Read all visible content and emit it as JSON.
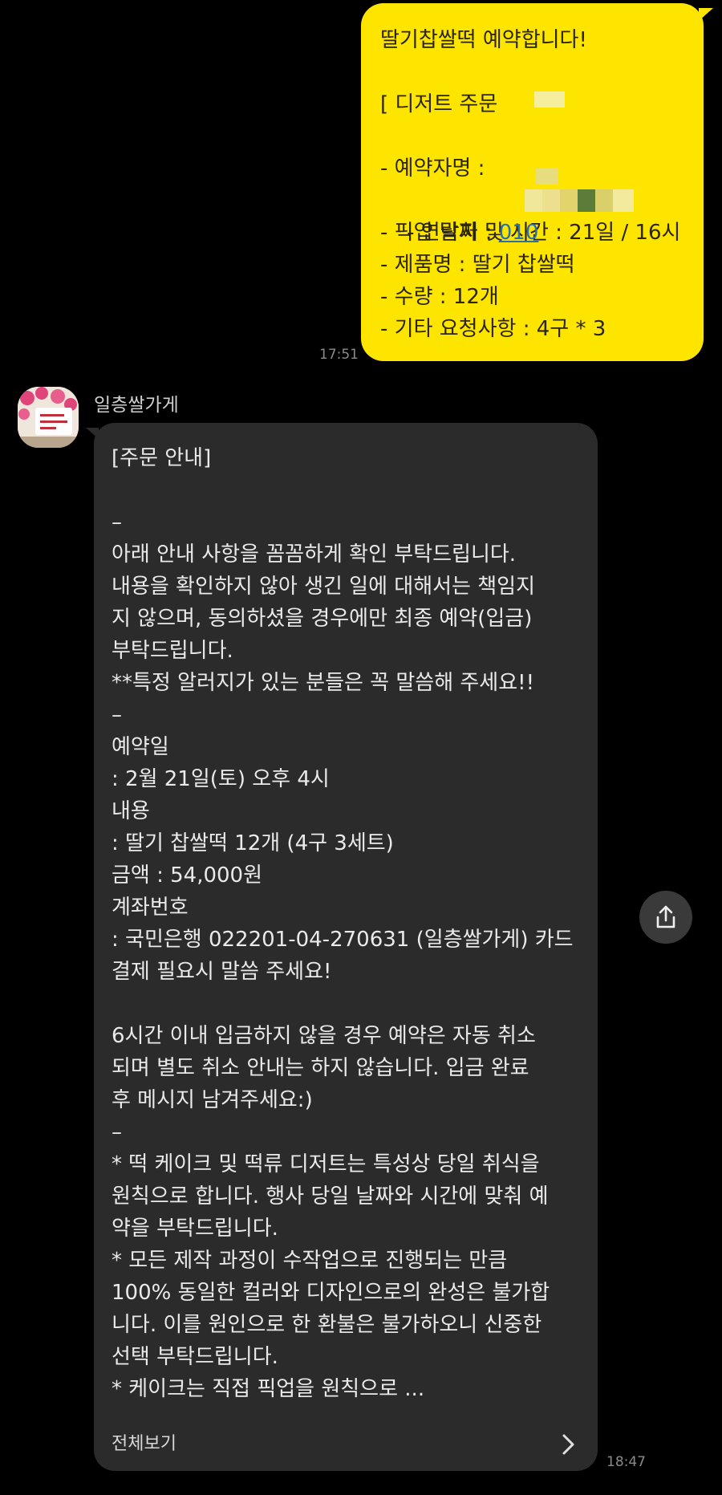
{
  "outgoing": {
    "lines": [
      "딸기찹쌀떡 예약합니다!",
      "",
      "[ 디저트 주문",
      "",
      "- 예약자명 :",
      "- 연락처 : ",
      "- 픽업 날짜 및 시간 : 21일 / 16시",
      "- 제품명 : 딸기 찹쌀떡",
      "- 수량 : 12개",
      "- 기타 요청사항 : 4구 * 3"
    ],
    "phone_prefix": "010",
    "time": "17:51",
    "bubble_color": "#FEE500"
  },
  "incoming": {
    "sender": "일층쌀가게",
    "avatar_icon": "store-logo-icon",
    "lines": [
      "[주문 안내]",
      "",
      "–",
      "아래 안내 사항을 꼼꼼하게 확인 부탁드립니다.",
      "내용을 확인하지 않아 생긴 일에 대해서는 책임지",
      "지 않으며, 동의하셨을 경우에만 최종 예약(입금)",
      "부탁드립니다.",
      "**특정 알러지가 있는 분들은 꼭 말씀해 주세요!!",
      "–",
      "예약일",
      ": 2월 21일(토) 오후 4시",
      "내용",
      ": 딸기 찹쌀떡 12개 (4구 3세트)",
      "금액 : 54,000원",
      "계좌번호",
      ": 국민은행 022201-04-270631 (일층쌀가게) 카드",
      "결제 필요시 말씀 주세요!",
      "",
      "6시간 이내 입금하지 않을 경우 예약은 자동 취소",
      "되며 별도 취소 안내는 하지 않습니다. 입금 완료",
      "후 메시지 남겨주세요:)",
      "–",
      "* 떡 케이크 및 떡류 디저트는 특성상 당일 취식을",
      "원칙으로 합니다. 행사 당일 날짜와 시간에 맞춰 예",
      "약을 부탁드립니다.",
      "* 모든 제작 과정이 수작업으로 진행되는 만큼",
      "100% 동일한 컬러와 디자인으로의 완성은 불가합",
      "니다. 이를 원인으로 한 환불은 불가하오니 신중한",
      "선택 부탁드립니다.",
      "* 케이크는 직접 픽업을 원칙으로 ..."
    ],
    "see_all": "전체보기",
    "time": "18:47",
    "bubble_color": "#2b2b2b"
  },
  "share_button_icon": "share-icon"
}
